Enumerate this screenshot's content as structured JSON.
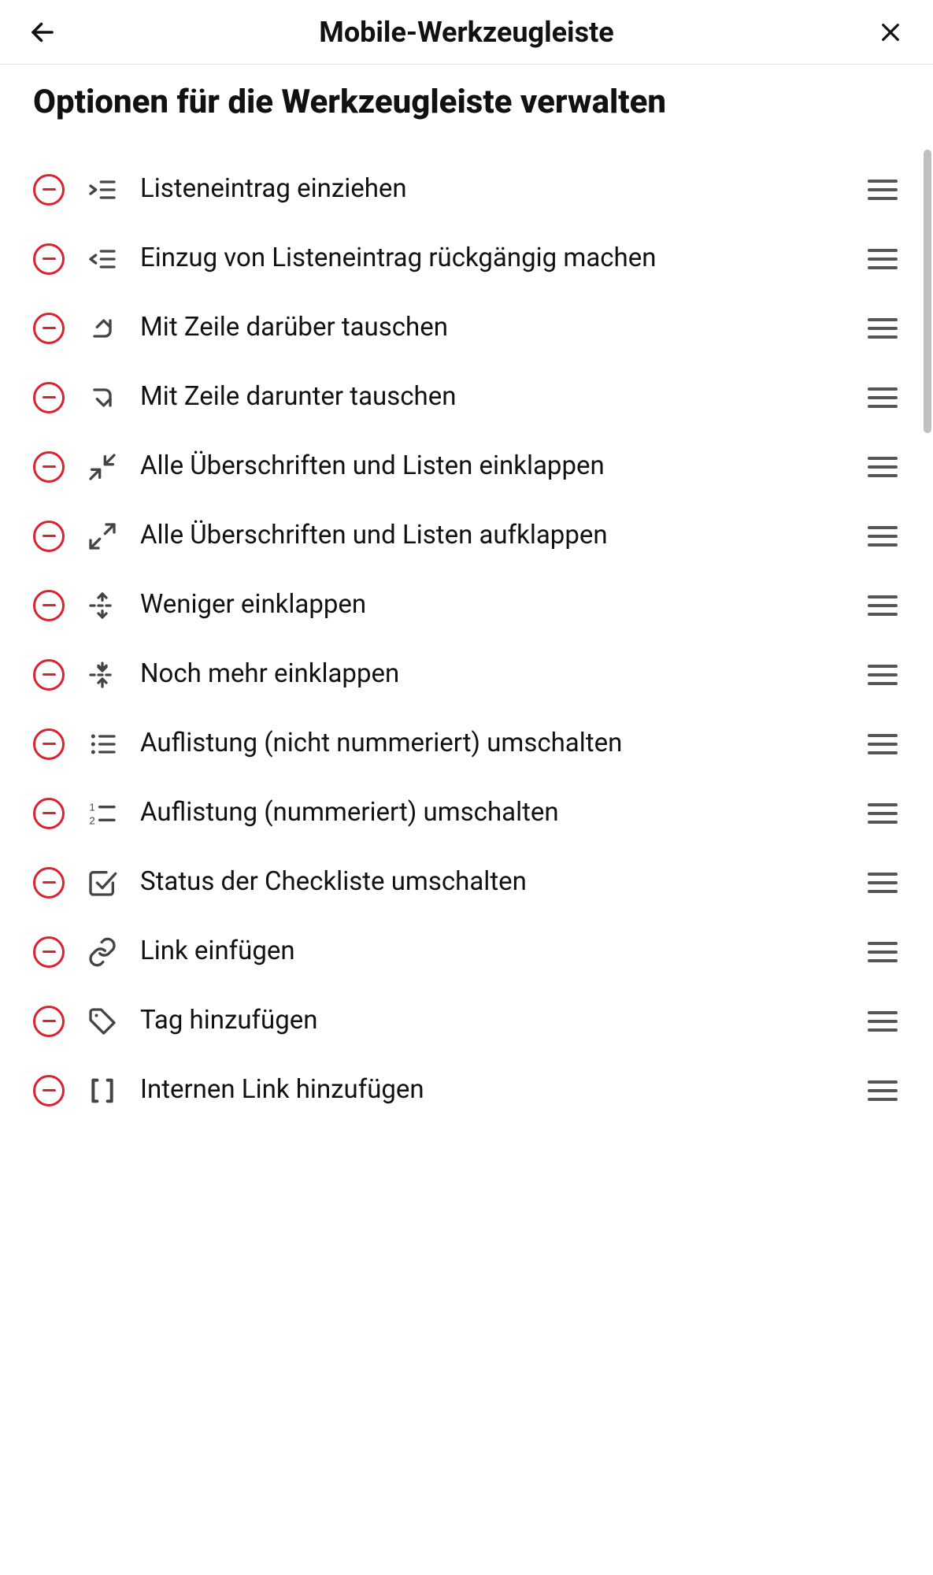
{
  "header": {
    "title": "Mobile-Werkzeugleiste"
  },
  "section_title": "Optionen für die Werkzeugleiste verwalten",
  "items": [
    {
      "id": "indent-list",
      "label": "Listeneintrag einziehen"
    },
    {
      "id": "unindent-list",
      "label": "Einzug von Listeneintrag rückgängig machen"
    },
    {
      "id": "swap-line-up",
      "label": "Mit Zeile darüber tauschen"
    },
    {
      "id": "swap-line-down",
      "label": "Mit Zeile darunter tauschen"
    },
    {
      "id": "fold-all",
      "label": "Alle Überschriften und Listen einklappen"
    },
    {
      "id": "unfold-all",
      "label": "Alle Überschriften und Listen aufklappen"
    },
    {
      "id": "fold-less",
      "label": "Weniger einklappen"
    },
    {
      "id": "fold-more",
      "label": "Noch mehr einklappen"
    },
    {
      "id": "toggle-bullet-list",
      "label": "Auflistung (nicht nummeriert) umschalten"
    },
    {
      "id": "toggle-number-list",
      "label": "Auflistung (nummeriert) umschalten"
    },
    {
      "id": "toggle-checklist",
      "label": "Status der Checkliste umschalten"
    },
    {
      "id": "insert-link",
      "label": "Link einfügen"
    },
    {
      "id": "add-tag",
      "label": "Tag hinzufügen"
    },
    {
      "id": "add-internal-link",
      "label": "Internen Link hinzufügen"
    }
  ]
}
